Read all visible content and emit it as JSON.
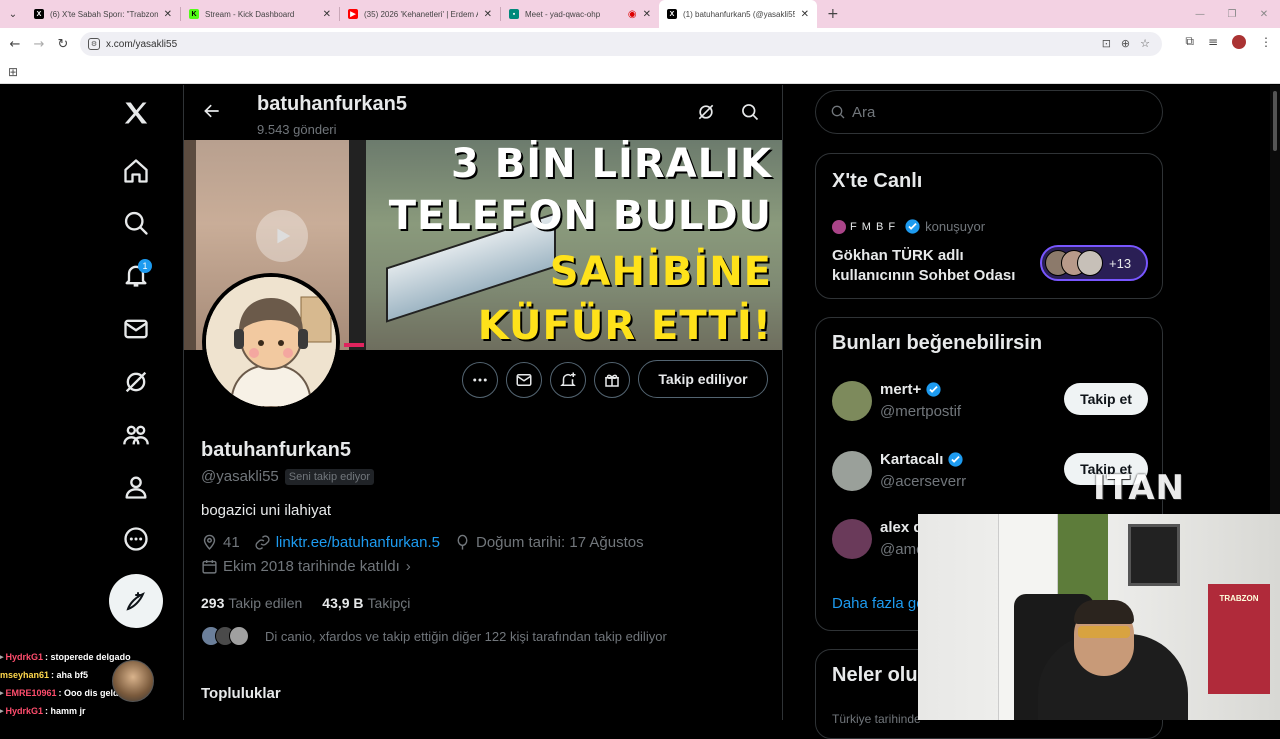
{
  "browser": {
    "tabs": [
      {
        "title": "(6) X'te Sabah Sporı: \"Trabzonspor",
        "icon": "x-icon",
        "color": "#000000",
        "active": false
      },
      {
        "title": "Stream - Kick Dashboard",
        "icon": "kick-icon",
        "color": "#53fc18",
        "active": false
      },
      {
        "title": "(35) 2026 'Kehanetleri' | Erdem A",
        "icon": "youtube-icon",
        "color": "#ff0000",
        "active": false
      },
      {
        "title": "Meet - yad-qwac-ohp",
        "icon": "meet-icon",
        "color": "#00897b",
        "active": false
      },
      {
        "title": "(1) batuhanfurkan5 (@yasakli55",
        "icon": "x-icon",
        "color": "#000000",
        "active": true
      }
    ],
    "url": "x.com/yasakli55"
  },
  "profile_header": {
    "name": "batuhanfurkan5",
    "posts_count": "9.543 gönderi"
  },
  "banner": {
    "headline_line1": "3 BİN LİRALIK",
    "headline_line2": "TELEFON BULDU",
    "headline_line3": "SAHİBİNE",
    "headline_line4": "KÜFÜR ETTİ!"
  },
  "actions": {
    "follow_state": "Takip ediliyor"
  },
  "profile": {
    "display_name": "batuhanfurkan5",
    "handle": "@yasakli55",
    "follows_you": "Seni takip ediyor",
    "bio": "bogazici uni ilahiyat",
    "location": "41",
    "link": "linktr.ee/batuhanfurkan.5",
    "birthday": "Doğum tarihi: 17 Ağustos",
    "joined": "Ekim 2018 tarihinde katıldı",
    "following_count": "293",
    "following_label": "Takip edilen",
    "followers_count": "43,9 B",
    "followers_label": "Takipçi",
    "followed_by": "Di canio, xfardos ve takip ettiğin diğer 122 kişi tarafından takip ediliyor",
    "communities_title": "Topluluklar"
  },
  "sidebar": {
    "search_placeholder": "Ara",
    "live": {
      "title": "X'te Canlı",
      "host": "F M B F",
      "host_status": "konuşuyor",
      "room_title": "Gökhan TÜRK adlı kullanıcının Sohbet Odası",
      "listeners_more": "+13"
    },
    "suggestions": {
      "title": "Bunları beğenebilirsin",
      "items": [
        {
          "name": "mert+",
          "handle": "@mertpostif",
          "button": "Takip et"
        },
        {
          "name": "Kartacalı",
          "handle": "@acerseverr",
          "button": "Takip et"
        },
        {
          "name": "alex d",
          "handle": "@amc",
          "button": ""
        }
      ],
      "more": "Daha fazla gö"
    },
    "trending": {
      "title": "Neler olu",
      "subtitle": "Türkiye tarihinde"
    }
  },
  "notifications_badge": "1",
  "stream_chat": [
    {
      "user": "HydrkG1",
      "msg": ": stoperede delgado",
      "color": "#ff4d6d"
    },
    {
      "user": "mseyhan61",
      "msg": ": aha bf5",
      "color": "#ffd84d"
    },
    {
      "user": "EMRE10961",
      "msg": ": Ooo dis geldi",
      "color": "#ff4d6d"
    },
    {
      "user": "HydrkG1",
      "msg": ": hamm jr",
      "color": "#ff4d6d"
    }
  ],
  "stream_logo": "ITAN",
  "webcam_jersey": "TRABZON",
  "colors": {
    "accent": "#1d9bf0",
    "text_secondary": "#71767b",
    "border": "#2f3336",
    "tabbar": "#f3d2e3"
  }
}
